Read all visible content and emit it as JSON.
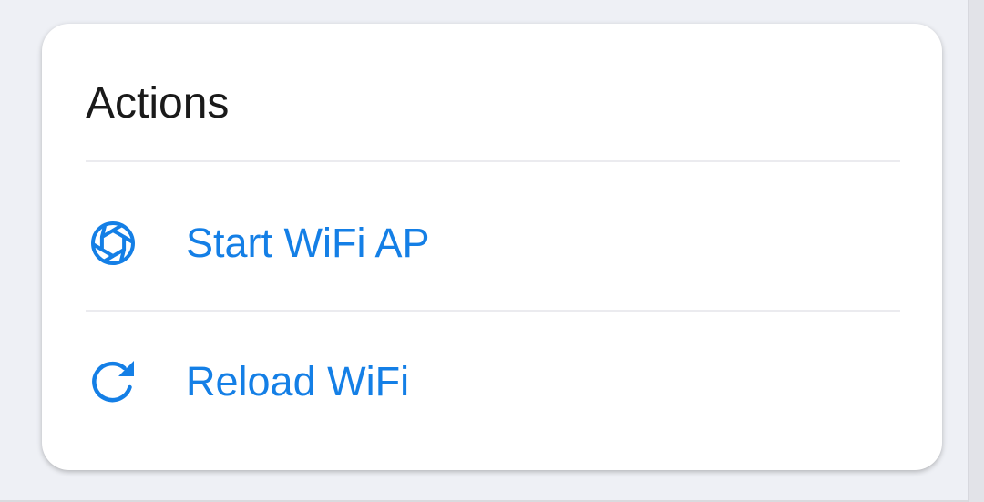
{
  "actions_card": {
    "title": "Actions",
    "items": [
      {
        "label": "Start WiFi AP",
        "icon": "aperture-icon"
      },
      {
        "label": "Reload WiFi",
        "icon": "reload-icon"
      }
    ]
  },
  "colors": {
    "accent": "#147fe6",
    "title_text": "#1a1a1a",
    "page_background": "#eef0f5",
    "card_background": "#ffffff"
  }
}
